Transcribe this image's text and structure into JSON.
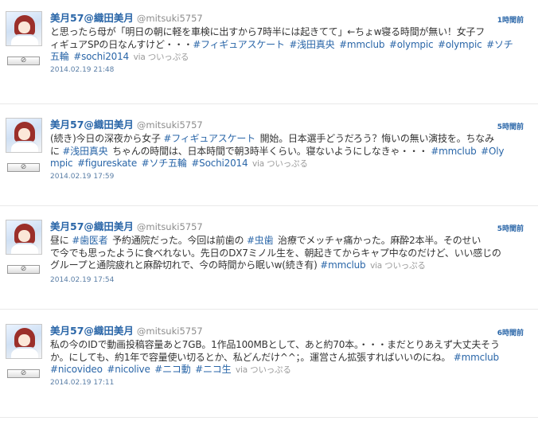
{
  "tweets": [
    {
      "name": "美月57@織田美月",
      "handle": "@mitsuki5757",
      "time_ago": "1時間前",
      "fav_label": "⊘",
      "date": "2014.02.19 21:48",
      "via": "via ついっぷる",
      "lines": [
        [
          {
            "t": "と思ったら母が「明日の朝に軽を車検に出すから7時半には起きてて」←ちょw寝る時間が無い！女子フ",
            "tag": false
          }
        ],
        [
          {
            "t": "ィギュアSPの日なんすけど・・・",
            "tag": false
          },
          {
            "t": "#フィギュアスケート",
            "tag": true
          },
          {
            "t": "#浅田真央",
            "tag": true
          },
          {
            "t": "#mmclub",
            "tag": true
          },
          {
            "t": "#olympic",
            "tag": true
          },
          {
            "t": "#olympic",
            "tag": true
          },
          {
            "t": "#ソチ",
            "tag": true
          }
        ],
        [
          {
            "t": "五輪",
            "tag": true
          },
          {
            "t": "#sochi2014",
            "tag": true
          }
        ]
      ]
    },
    {
      "name": "美月57@織田美月",
      "handle": "@mitsuki5757",
      "time_ago": "5時間前",
      "fav_label": "⊘",
      "date": "2014.02.19 17:59",
      "via": "via ついっぷる",
      "lines": [
        [
          {
            "t": "(続き)今日の深夜から女子 ",
            "tag": false
          },
          {
            "t": "#フィギュアスケート",
            "tag": true
          },
          {
            "t": " 開始。日本選手どうだろう？悔いの無い演技を。ちなみ",
            "tag": false
          }
        ],
        [
          {
            "t": "に ",
            "tag": false
          },
          {
            "t": "#浅田真央",
            "tag": true
          },
          {
            "t": " ちゃんの時間は、日本時間で朝3時半くらい。寝ないようにしなきゃ・・・ ",
            "tag": false
          },
          {
            "t": "#mmclub",
            "tag": true
          },
          {
            "t": "#Oly",
            "tag": true
          }
        ],
        [
          {
            "t": "mpic",
            "tag": true
          },
          {
            "t": "#figureskate",
            "tag": true
          },
          {
            "t": "#ソチ五輪",
            "tag": true
          },
          {
            "t": "#Sochi2014",
            "tag": true
          }
        ]
      ]
    },
    {
      "name": "美月57@織田美月",
      "handle": "@mitsuki5757",
      "time_ago": "5時間前",
      "fav_label": "⊘",
      "date": "2014.02.19 17:54",
      "via": "via ついっぷる",
      "lines": [
        [
          {
            "t": "昼に ",
            "tag": false
          },
          {
            "t": "#歯医者",
            "tag": true
          },
          {
            "t": " 予約通院だった。今回は前歯の ",
            "tag": false
          },
          {
            "t": "#虫歯",
            "tag": true
          },
          {
            "t": " 治療でメッチャ痛かった。麻酔2本半。そのせい",
            "tag": false
          }
        ],
        [
          {
            "t": "で今でも思ったように食べれない。先日のDX7ミノル生を、朝起きてからキャプ中なのだけど、いい感じの",
            "tag": false
          }
        ],
        [
          {
            "t": "グループと通院疲れと麻酔切れで、今の時間から眠いw(続き有) ",
            "tag": false
          },
          {
            "t": "#mmclub",
            "tag": true
          }
        ]
      ]
    },
    {
      "name": "美月57@織田美月",
      "handle": "@mitsuki5757",
      "time_ago": "6時間前",
      "fav_label": "⊘",
      "date": "2014.02.19 17:11",
      "via": "via ついっぷる",
      "lines": [
        [
          {
            "t": "私の今のIDで動画投稿容量あと7GB。1作品100MBとして、あと約70本。・・・まだとりあえず大丈夫そう",
            "tag": false
          }
        ],
        [
          {
            "t": "か。にしても、約1年で容量使い切るとか、私どんだけ^^；。運営さん拡張すればいいのにね。 ",
            "tag": false
          },
          {
            "t": "#mmclub",
            "tag": true
          }
        ],
        [
          {
            "t": "#nicovideo",
            "tag": true
          },
          {
            "t": "#nicolive",
            "tag": true
          },
          {
            "t": "#ニコ動",
            "tag": true
          },
          {
            "t": "#ニコ生",
            "tag": true
          }
        ]
      ]
    }
  ]
}
